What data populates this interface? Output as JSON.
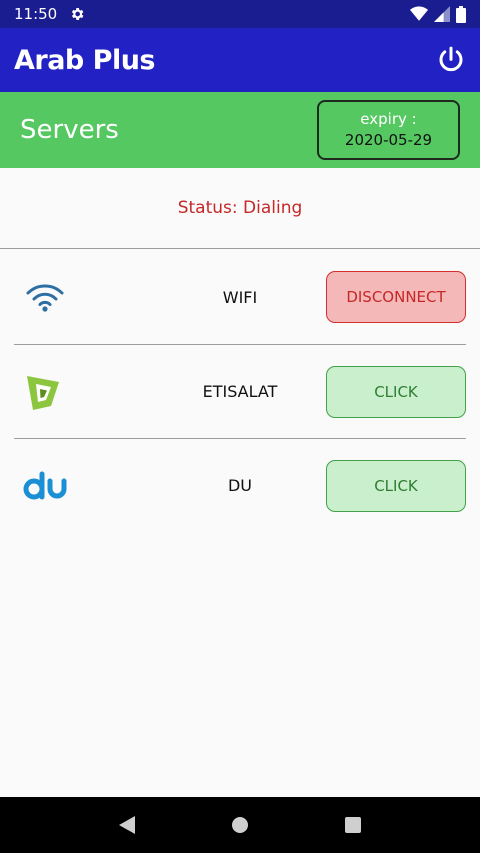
{
  "status_bar": {
    "time": "11:50",
    "icons": [
      "gear-icon",
      "wifi-icon",
      "signal-icon",
      "battery-icon"
    ]
  },
  "app_bar": {
    "title": "Arab Plus",
    "power_icon": "power-icon"
  },
  "servers_header": {
    "title": "Servers",
    "expiry_label": "expiry :",
    "expiry_date": "2020-05-29"
  },
  "status": {
    "text": "Status: Dialing"
  },
  "servers": [
    {
      "name": "WIFI",
      "icon": "wifi-logo-icon",
      "button": "DISCONNECT",
      "state": "connected"
    },
    {
      "name": "ETISALAT",
      "icon": "etisalat-logo-icon",
      "button": "CLICK",
      "state": "idle"
    },
    {
      "name": "DU",
      "icon": "du-logo-icon",
      "button": "CLICK",
      "state": "idle"
    }
  ],
  "colors": {
    "status_bar": "#1a1d8f",
    "app_bar": "#2222c4",
    "servers_bar": "#55c862",
    "status_text": "#c62828",
    "disconnect_bg": "#f4b8b8",
    "click_bg": "#c9efcc"
  },
  "nav_bar": {
    "icons": [
      "back-icon",
      "home-icon",
      "recents-icon"
    ]
  }
}
